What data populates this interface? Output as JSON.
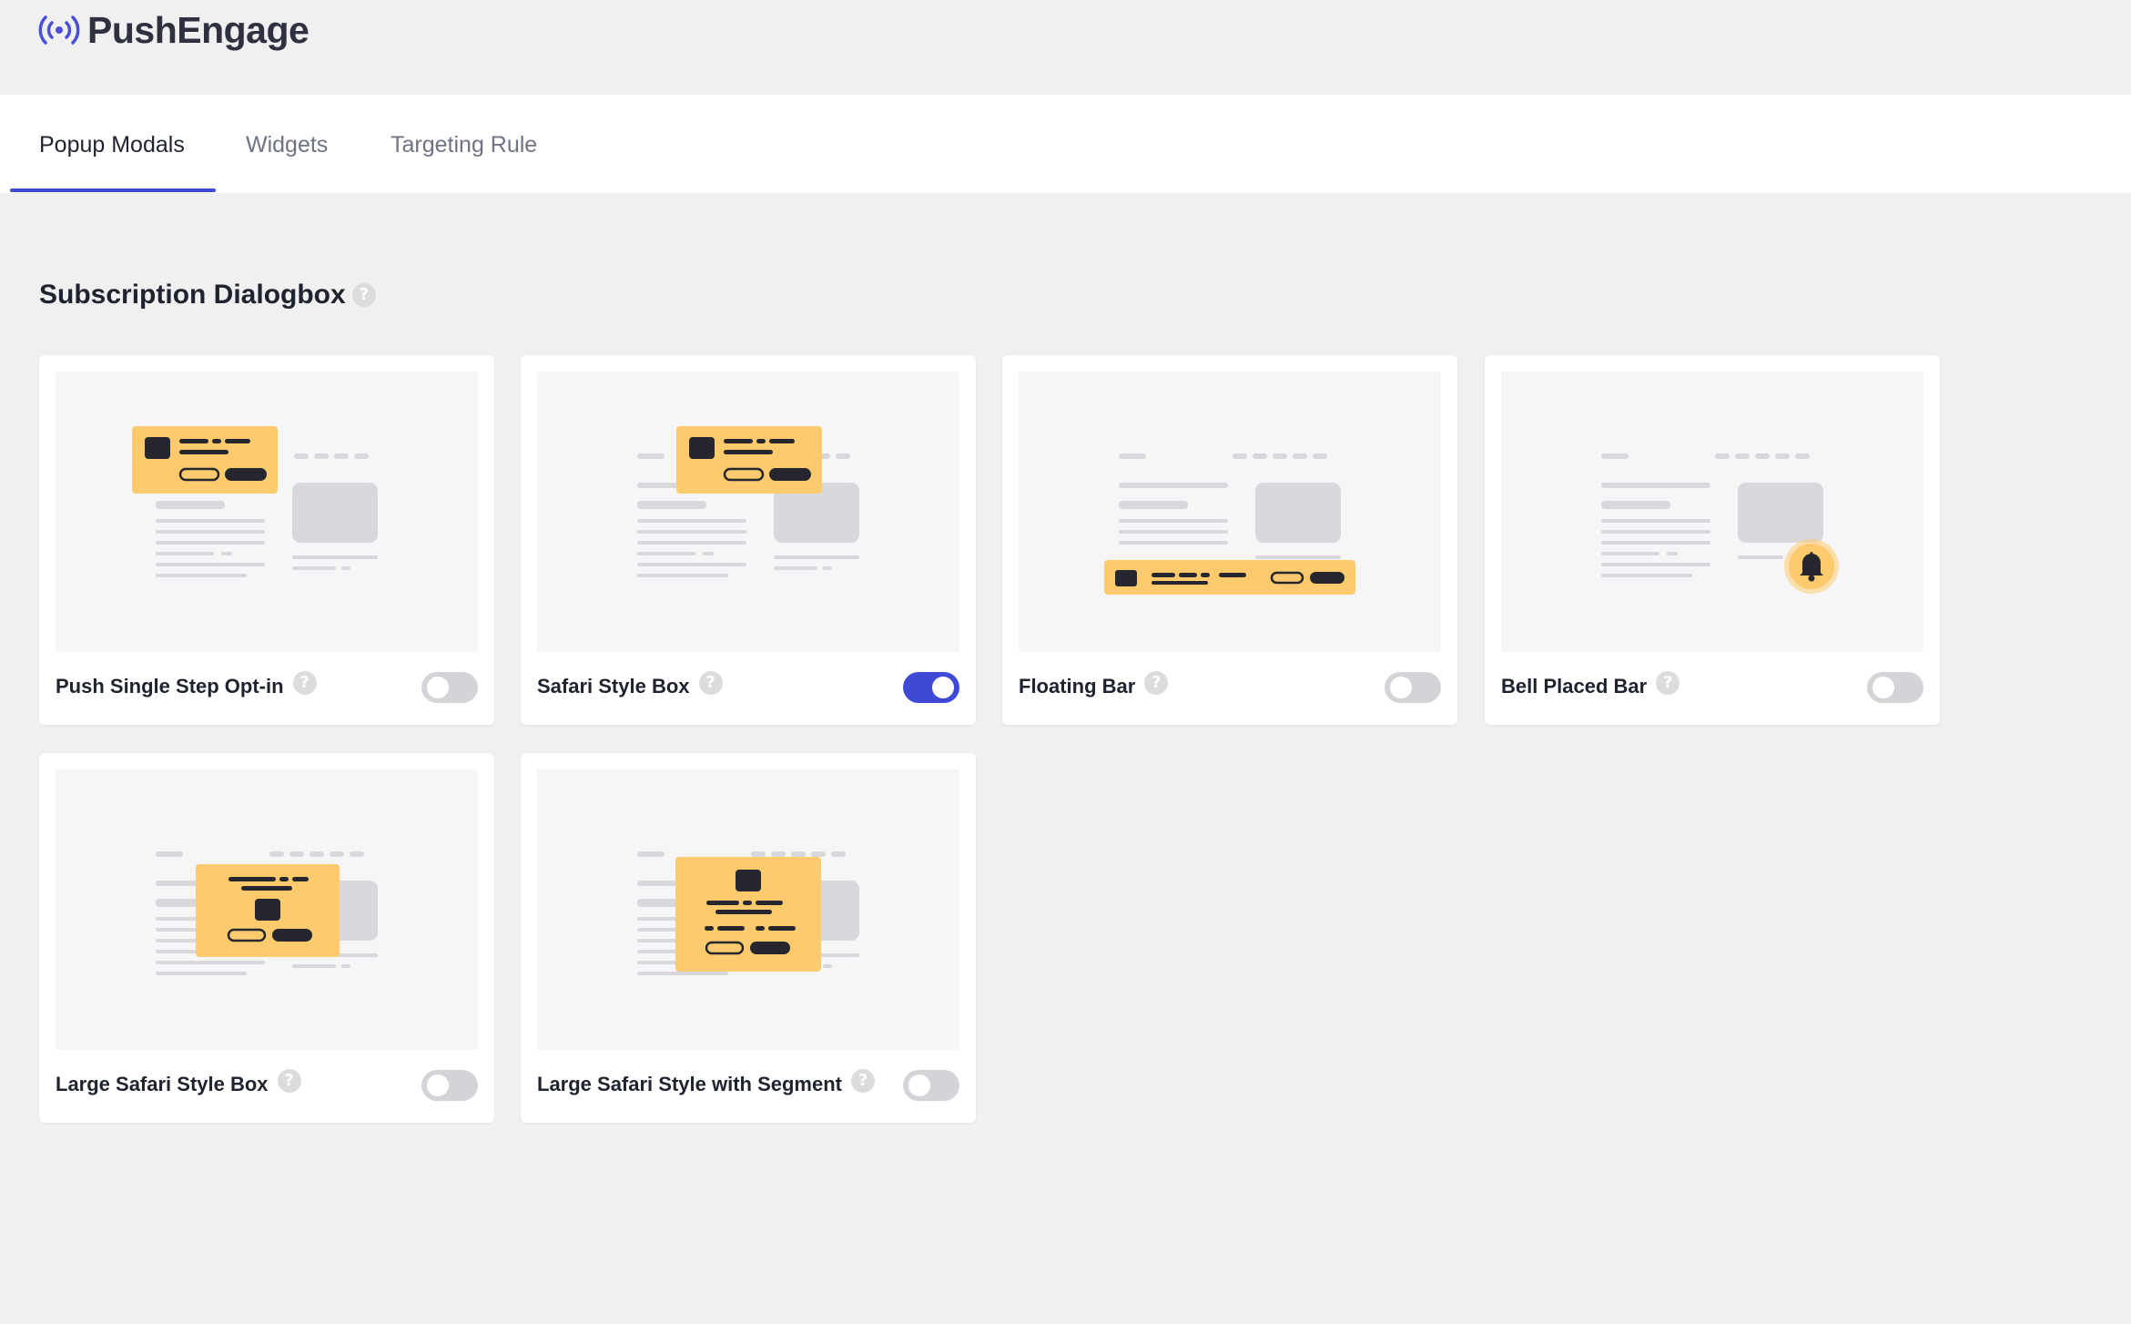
{
  "brand": {
    "name": "PushEngage",
    "logo_color": "#4a4fd8"
  },
  "tabs": [
    {
      "label": "Popup Modals",
      "active": true
    },
    {
      "label": "Widgets",
      "active": false
    },
    {
      "label": "Targeting Rule",
      "active": false
    }
  ],
  "section": {
    "title": "Subscription Dialogbox",
    "help_icon": "question-circle-icon"
  },
  "cards": [
    {
      "label": "Push Single Step Opt-in",
      "enabled": false
    },
    {
      "label": "Safari Style Box",
      "enabled": true
    },
    {
      "label": "Floating Bar",
      "enabled": false
    },
    {
      "label": "Bell Placed Bar",
      "enabled": false
    },
    {
      "label": "Large Safari Style Box",
      "enabled": false
    },
    {
      "label": "Large Safari Style with Segment",
      "enabled": false
    }
  ],
  "colors": {
    "accent": "#3f49d6",
    "toggle_off": "#d4d4d8",
    "preview_highlight": "#fdca6e",
    "preview_skeleton": "#d8d8dc",
    "preview_dark": "#25262e"
  }
}
